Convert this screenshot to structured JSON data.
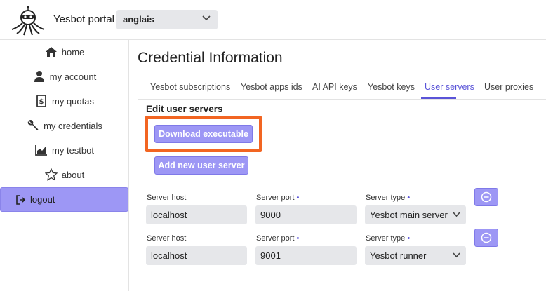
{
  "header": {
    "brand": "Yesbot portal",
    "language": {
      "selected": "anglais"
    }
  },
  "sidebar": {
    "items": [
      {
        "label": "home",
        "icon": "home-icon"
      },
      {
        "label": "my account",
        "icon": "user-icon"
      },
      {
        "label": "my quotas",
        "icon": "dollar-document-icon"
      },
      {
        "label": "my credentials",
        "icon": "wrench-icon"
      },
      {
        "label": "my testbot",
        "icon": "chart-icon"
      },
      {
        "label": "about",
        "icon": "star-icon"
      }
    ],
    "logout": {
      "label": "logout",
      "icon": "logout-icon"
    }
  },
  "main": {
    "title": "Credential Information",
    "tabs": [
      {
        "label": "Yesbot subscriptions",
        "active": false
      },
      {
        "label": "Yesbot apps ids",
        "active": false
      },
      {
        "label": "AI API keys",
        "active": false
      },
      {
        "label": "Yesbot keys",
        "active": false
      },
      {
        "label": "User servers",
        "active": true
      },
      {
        "label": "User proxies",
        "active": false
      }
    ],
    "section_title": "Edit user servers",
    "download_button": "Download executable",
    "add_button": "Add new user server",
    "required_marker": "•",
    "labels": {
      "host": "Server host",
      "port": "Server port",
      "type": "Server type"
    },
    "servers": [
      {
        "host": "localhost",
        "port": "9000",
        "type": "Yesbot main server"
      },
      {
        "host": "localhost",
        "port": "9001",
        "type": "Yesbot runner"
      }
    ]
  },
  "colors": {
    "accent": "#9d97f5",
    "active_tab": "#5a54d8",
    "highlight": "#f26522",
    "field_bg": "#e6e7ea"
  }
}
